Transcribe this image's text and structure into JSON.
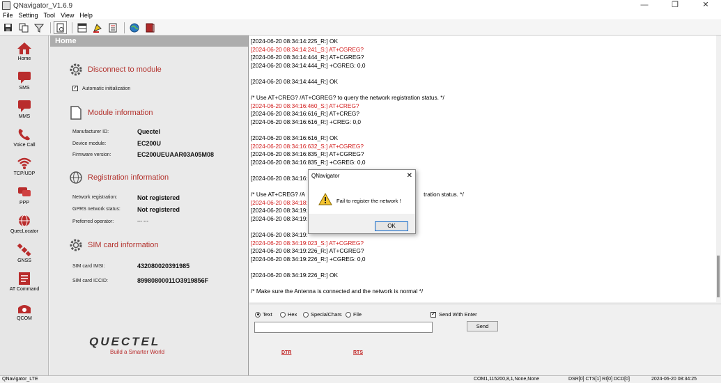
{
  "window": {
    "title": "QNavigator_V1.6.9",
    "controls": [
      "—",
      "❐",
      "✕"
    ]
  },
  "menu": {
    "items": [
      "File",
      "Setting",
      "Tool",
      "View",
      "Help"
    ]
  },
  "sidebar": {
    "items": [
      {
        "label": "Home",
        "icon": "home-icon"
      },
      {
        "label": "SMS",
        "icon": "sms-icon"
      },
      {
        "label": "MMS",
        "icon": "mms-icon"
      },
      {
        "label": "Voice Call",
        "icon": "phone-icon"
      },
      {
        "label": "TCP/UDP",
        "icon": "wifi-icon"
      },
      {
        "label": "PPP",
        "icon": "ppp-icon"
      },
      {
        "label": "QuecLocator",
        "icon": "globe-icon"
      },
      {
        "label": "GNSS",
        "icon": "satellite-icon"
      },
      {
        "label": "AT Command",
        "icon": "terminal-icon"
      },
      {
        "label": "QCOM",
        "icon": "qcom-icon"
      }
    ]
  },
  "home": {
    "header": "Home",
    "disconnect": {
      "title": "Disconnect to module",
      "auto_init_label": "Automatic initialization",
      "auto_init_checked": true
    },
    "module": {
      "title": "Module information",
      "manufacturer_label": "Manufacturer ID:",
      "manufacturer": "Quectel",
      "device_label": "Device module:",
      "device": "EC200U",
      "firmware_label": "Firmware version:",
      "firmware": "EC200UEUAAR03A05M08"
    },
    "registration": {
      "title": "Registration information",
      "network_label": "Network registration:",
      "network": "Not registered",
      "gprs_label": "GPRS network status:",
      "gprs": "Not registered",
      "operator_label": "Preferred operator:",
      "operator": "--- ---"
    },
    "sim": {
      "title": "SIM card information",
      "imsi_label": "SIM card IMSI:",
      "imsi": "432080020391985",
      "iccid_label": "SIM card ICCID:",
      "iccid": "89980800011O3919856F"
    },
    "logo": {
      "brand": "QUECTEL",
      "tagline": "Build a Smarter World"
    }
  },
  "log": {
    "lines": [
      {
        "text": "[2024-06-20 08:34:14:225_R:] OK",
        "sent": false
      },
      {
        "text": "[2024-06-20 08:34:14:241_S:] AT+CGREG?",
        "sent": true
      },
      {
        "text": "[2024-06-20 08:34:14:444_R:] AT+CGREG?",
        "sent": false
      },
      {
        "text": "[2024-06-20 08:34:14:444_R:] +CGREG: 0,0",
        "sent": false
      },
      {
        "text": "",
        "sent": false
      },
      {
        "text": "[2024-06-20 08:34:14:444_R:] OK",
        "sent": false
      },
      {
        "text": "",
        "sent": false
      },
      {
        "text": "/* Use AT+CREG? /AT+CGREG? to query the network registration status. */",
        "sent": false
      },
      {
        "text": "[2024-06-20 08:34:16:460_S:] AT+CREG?",
        "sent": true
      },
      {
        "text": "[2024-06-20 08:34:16:616_R:] AT+CREG?",
        "sent": false
      },
      {
        "text": "[2024-06-20 08:34:16:616_R:] +CREG: 0,0",
        "sent": false
      },
      {
        "text": "",
        "sent": false
      },
      {
        "text": "[2024-06-20 08:34:16:616_R:] OK",
        "sent": false
      },
      {
        "text": "[2024-06-20 08:34:16:632_S:] AT+CGREG?",
        "sent": true
      },
      {
        "text": "[2024-06-20 08:34:16:835_R:] AT+CGREG?",
        "sent": false
      },
      {
        "text": "[2024-06-20 08:34:16:835_R:] +CGREG: 0,0",
        "sent": false
      },
      {
        "text": "",
        "sent": false
      },
      {
        "text": "[2024-06-20 08:34:16:8",
        "sent": false
      },
      {
        "text": "",
        "sent": false
      },
      {
        "text": "/* Use AT+CREG? /A                                                                          tration status. */",
        "sent": false
      },
      {
        "text": "[2024-06-20 08:34:18:",
        "sent": true
      },
      {
        "text": "[2024-06-20 08:34:19:",
        "sent": false
      },
      {
        "text": "[2024-06-20 08:34:19:",
        "sent": false
      },
      {
        "text": "",
        "sent": false
      },
      {
        "text": "[2024-06-20 08:34:19:",
        "sent": false
      },
      {
        "text": "[2024-06-20 08:34:19:023_S:] AT+CGREG?",
        "sent": true
      },
      {
        "text": "[2024-06-20 08:34:19:226_R:] AT+CGREG?",
        "sent": false
      },
      {
        "text": "[2024-06-20 08:34:19:226_R:] +CGREG: 0,0",
        "sent": false
      },
      {
        "text": "",
        "sent": false
      },
      {
        "text": "[2024-06-20 08:34:19:226_R:] OK",
        "sent": false
      },
      {
        "text": "",
        "sent": false
      },
      {
        "text": "/* Make sure the Antenna is connected and the network is normal */",
        "sent": false
      }
    ]
  },
  "send": {
    "modes": [
      "Text",
      "Hex",
      "SpecialChars",
      "File"
    ],
    "selected_mode": "Text",
    "send_with_enter_label": "Send With Enter",
    "send_with_enter_checked": true,
    "input_value": "",
    "send_label": "Send",
    "dtr_label": "DTR",
    "rts_label": "RTS"
  },
  "status": {
    "app": "QNavigator_LTE",
    "port": "COM1,115200,8,1,None,None",
    "signals": "DSR[0] CTS[1] RI[0] DCD[0]",
    "time": "2024-06-20 08:34:25"
  },
  "dialog": {
    "title": "QNavigator",
    "message": "Fail to register the network !",
    "ok_label": "OK",
    "close": "✕"
  }
}
